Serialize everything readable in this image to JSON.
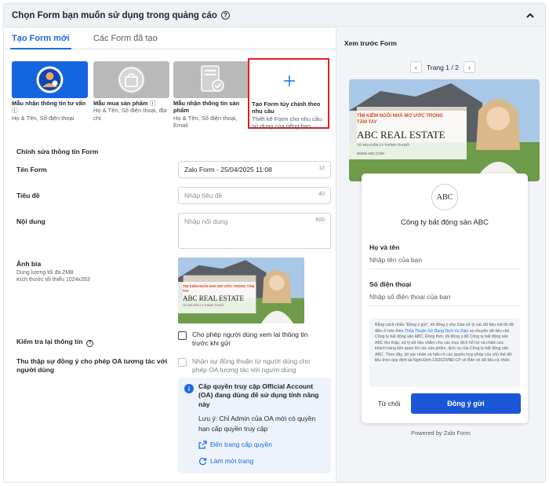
{
  "header": {
    "title": "Chọn Form bạn muốn sử dụng trong quảng cáo"
  },
  "tabs": [
    {
      "label": "Tạo Form mới",
      "active": true
    },
    {
      "label": "Các Form đã tạo",
      "active": false
    }
  ],
  "templates": [
    {
      "name": "Mẫu nhận thông tin tư vấn",
      "desc": "Họ & Tên, Số điện thoại"
    },
    {
      "name": "Mẫu mua sản phẩm",
      "desc": "Họ & Tên, Số điện thoại, địa chỉ"
    },
    {
      "name": "Mẫu nhận thông tin sản phẩm",
      "desc": "Họ & Tên, Số điện thoại, Email"
    },
    {
      "name": "Tạo Form tùy chỉnh theo nhu cầu",
      "desc": "Thiết kế Form cho nhu cầu sử dụng của riêng bạn"
    }
  ],
  "edit": {
    "section_title": "Chỉnh sửa thông tin Form",
    "form_name_label": "Tên Form",
    "form_name_value": "Zalo Form - 25/04/2025 11:08",
    "form_name_count": "12",
    "title_label": "Tiêu đề",
    "title_placeholder": "Nhập tiêu đề",
    "title_count": "40",
    "content_label": "Nội dung",
    "content_placeholder": "Nhập nội dung",
    "content_count": "600",
    "cover_label": "Ảnh bìa",
    "cover_hint_1": "Dung lượng tối đa 2MB",
    "cover_hint_2": "Kích thước tối thiểu 1024x353",
    "review_label": "Kiểm tra lại thông tin",
    "review_check": "Cho phép người dùng xem lại thông tin trước khi gửi",
    "consent_label": "Thu thập sự đồng ý cho phép OA tương tác với người dùng",
    "consent_check": "Nhận sự đồng thuận từ người dùng cho phép OA tương tác với người dùng",
    "info_bold": "Cấp quyền truy cập Official Account (OA) đang dùng để sử dụng tính năng này",
    "info_note": "Lưu ý: Chỉ Admin của OA mới có quyền hạn cấp quyền truy cập",
    "info_link_1": "Đến trang cấp quyền",
    "info_link_2": "Làm mới trang"
  },
  "banner": {
    "tagline": "TÌM KIẾM NGÔI NHÀ MƠ ƯỚC TRONG TẦM TAY",
    "brand": "ABC REAL ESTATE",
    "small": "TỪ NGUYÊN LÝ THÀNH THỊ ĐÔ",
    "url": "WWW.ABC.COM"
  },
  "preview": {
    "title": "Xem trước Form",
    "pager": "Trang 1 / 2",
    "logo": "ABC",
    "company": "Công ty bất động sản ABC",
    "field_1_label": "Họ và tên",
    "field_1_placeholder": "Nhập tên của bạn",
    "field_2_label": "Số điện thoại",
    "field_2_placeholder": "Nhập số điện thoại của bạn",
    "consent_text_1": "Bằng cách nhấn “Đồng ý gửi”, tôi đồng ý cho Zalo xử lý các dữ liệu mà tôi đã điền ở trên theo",
    "consent_link": "Thỏa Thuận Sử Dụng Dịch Vụ Zalo",
    "consent_text_2": "và chuyển dữ liệu cho Công ty bất động sản ABC. Đồng thời, tôi đồng ý để Công ty bất động sản ABC thu thập, xử lý dữ liệu nhằm cho các mục đích hỗ trợ và chăm sóc khách hàng liên quan tới các sản phẩm, dịch vụ của Công ty bất động sản ABC. Theo đây, tôi xác nhận và hiểu rõ các quyền hợp pháp của chủ thể dữ liệu theo quy định tại Nghị Định 13/2023/NĐ-CP về Bảo vệ dữ liệu cá nhân.",
    "reject": "Từ chối",
    "agree": "Đồng ý gửi",
    "powered": "Powered by Zalo Form"
  },
  "colors": {
    "accent": "#1a6ae8",
    "highlight_border": "#e02020",
    "template_blue": "#1565e0"
  }
}
